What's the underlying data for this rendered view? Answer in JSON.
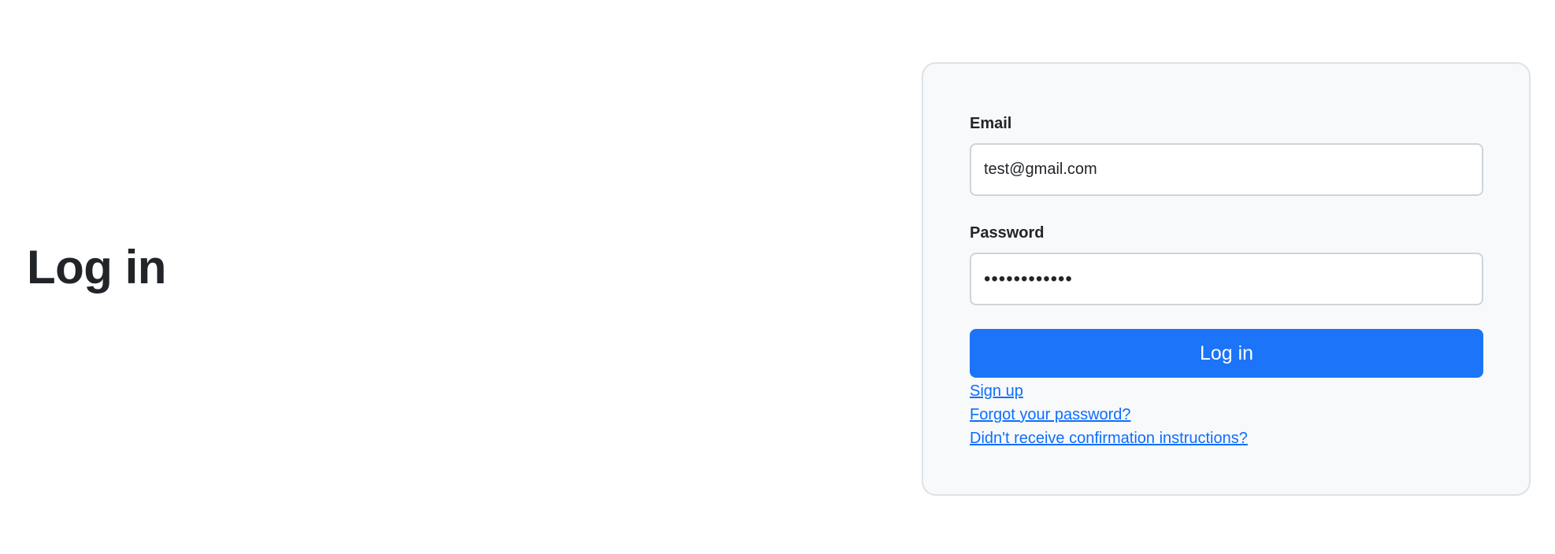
{
  "page": {
    "title": "Log in"
  },
  "form": {
    "email": {
      "label": "Email",
      "value": "test@gmail.com"
    },
    "password": {
      "label": "Password",
      "value": "••••••••••••"
    },
    "submit_label": "Log in",
    "links": {
      "sign_up": "Sign up",
      "forgot_password": "Forgot your password?",
      "confirmation": "Didn't receive confirmation instructions?"
    }
  },
  "colors": {
    "primary": "#1c74f8",
    "link": "#0d6efd",
    "card_background": "#f8f9fa",
    "card_border": "#dee2e6",
    "text": "#212529"
  }
}
